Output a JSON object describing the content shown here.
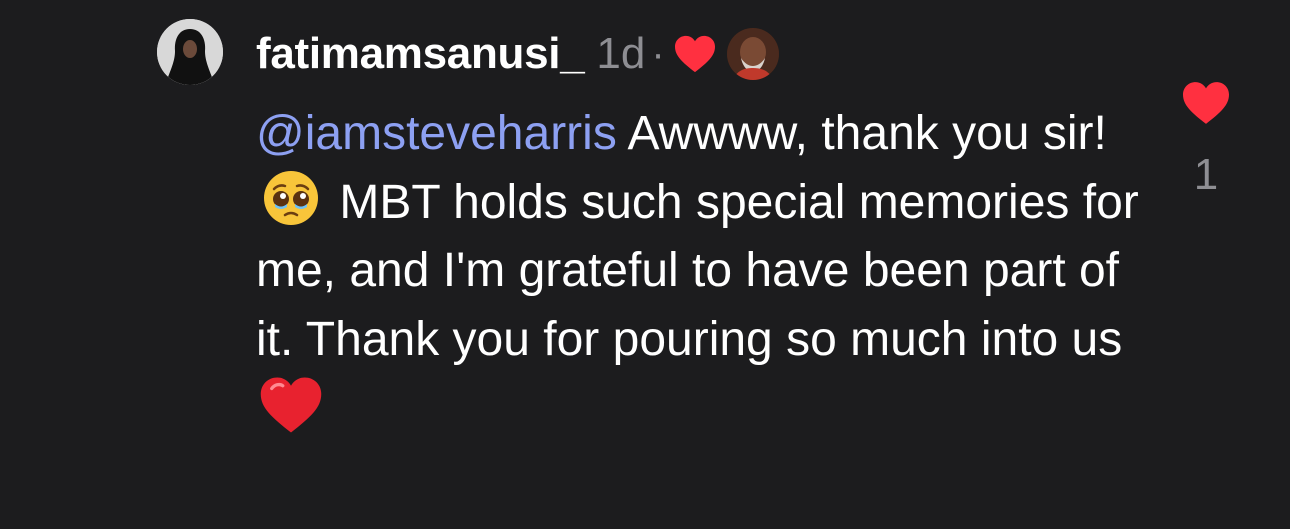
{
  "comment": {
    "username": "fatimamsanusi_",
    "time": "1d",
    "separator": "·",
    "mention": "@iamsteveharris",
    "text_part1": " Awwww, thank you sir! ",
    "text_part2": " MBT holds such special memories for me, and I'm grateful to have been part of it. Thank you for pouring so much into us",
    "emoji_icons": [
      "pleading-face-emoji-icon",
      "red-heart-emoji-icon"
    ],
    "liked_by_creator": true,
    "like_count": "1"
  },
  "colors": {
    "background": "#1c1c1e",
    "mention": "#8da0f2",
    "heart": "#ff3040",
    "muted": "#8e8e93"
  }
}
